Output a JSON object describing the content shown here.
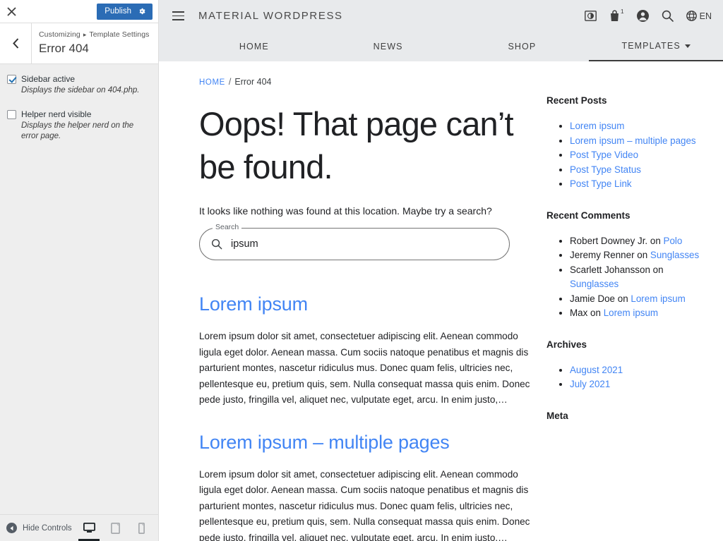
{
  "customizer": {
    "close_icon": "close-icon",
    "publish_label": "Publish",
    "publish_gear_icon": "gear-icon",
    "back_icon": "chevron-left-icon",
    "breadcrumb_prefix": "Customizing",
    "breadcrumb_sep": "▸",
    "breadcrumb_section": "Template Settings",
    "panel_title": "Error 404",
    "controls": [
      {
        "label": "Sidebar active",
        "description": "Displays the sidebar on 404.php.",
        "checked": true
      },
      {
        "label": "Helper nerd visible",
        "description": "Displays the helper nerd on the error page.",
        "checked": false
      }
    ],
    "footer": {
      "hide_controls_label": "Hide Controls",
      "hide_controls_icon": "arrow-left-circle-icon",
      "devices": [
        {
          "name": "desktop",
          "icon": "desktop-icon",
          "active": true
        },
        {
          "name": "tablet",
          "icon": "tablet-icon",
          "active": false
        },
        {
          "name": "mobile",
          "icon": "mobile-icon",
          "active": false
        }
      ]
    }
  },
  "site": {
    "menu_icon": "hamburger-menu-icon",
    "title": "MATERIAL WORDPRESS",
    "header_actions": [
      {
        "name": "contrast-toggle-icon",
        "label": ""
      },
      {
        "name": "shopping-bag-icon",
        "label": "1"
      },
      {
        "name": "account-icon",
        "label": ""
      },
      {
        "name": "search-icon",
        "label": ""
      }
    ],
    "language": {
      "icon": "globe-icon",
      "label": "EN"
    },
    "nav": [
      {
        "label": "HOME",
        "active": false,
        "has_caret": false
      },
      {
        "label": "NEWS",
        "active": false,
        "has_caret": false
      },
      {
        "label": "SHOP",
        "active": false,
        "has_caret": false
      },
      {
        "label": "TEMPLATES",
        "active": true,
        "has_caret": true
      }
    ],
    "breadcrumb": {
      "home": "HOME",
      "separator": "/",
      "current": "Error 404"
    },
    "error": {
      "title": "Oops! That page can’t be found.",
      "subtitle": "It looks like nothing was found at this location. Maybe try a search?"
    },
    "search": {
      "label": "Search",
      "value": "ipsum",
      "icon": "search-icon"
    },
    "posts": [
      {
        "title": "Lorem ipsum",
        "excerpt": "Lorem ipsum dolor sit amet, consectetuer adipiscing elit. Aenean commodo ligula eget dolor. Aenean massa. Cum sociis natoque penatibus et magnis dis parturient montes, nascetur ridiculus mus. Donec quam felis, ultricies nec, pellentesque eu, pretium quis, sem. Nulla consequat massa quis enim. Donec pede justo, fringilla vel, aliquet nec, vulputate eget, arcu. In enim justo,…"
      },
      {
        "title": "Lorem ipsum – multiple pages",
        "excerpt": "Lorem ipsum dolor sit amet, consectetuer adipiscing elit. Aenean commodo ligula eget dolor. Aenean massa. Cum sociis natoque penatibus et magnis dis parturient montes, nascetur ridiculus mus. Donec quam felis, ultricies nec, pellentesque eu, pretium quis, sem. Nulla consequat massa quis enim. Donec pede justo, fringilla vel, aliquet nec, vulputate eget, arcu. In enim justo,…"
      }
    ],
    "widgets": [
      {
        "title": "Recent Posts",
        "type": "links",
        "items": [
          {
            "text": "Lorem ipsum"
          },
          {
            "text": "Lorem ipsum – multiple pages"
          },
          {
            "text": "Post Type Video"
          },
          {
            "text": "Post Type Status"
          },
          {
            "text": "Post Type Link"
          }
        ]
      },
      {
        "title": "Recent Comments",
        "type": "comments",
        "items": [
          {
            "author": "Robert Downey Jr.",
            "on": "on",
            "post": "Polo"
          },
          {
            "author": "Jeremy Renner",
            "on": "on",
            "post": "Sunglasses"
          },
          {
            "author": "Scarlett Johansson",
            "on": "on",
            "post": "Sunglasses"
          },
          {
            "author": "Jamie Doe",
            "on": "on",
            "post": "Lorem ipsum"
          },
          {
            "author": "Max",
            "on": "on",
            "post": "Lorem ipsum"
          }
        ]
      },
      {
        "title": "Archives",
        "type": "links",
        "items": [
          {
            "text": "August 2021"
          },
          {
            "text": "July 2021"
          }
        ]
      },
      {
        "title": "Meta",
        "type": "links",
        "items": []
      }
    ]
  },
  "colors": {
    "publish_blue": "#2b6cb5",
    "link_blue": "#4285f4",
    "header_gray": "#e8eaec",
    "panel_gray": "#eeeeee"
  }
}
